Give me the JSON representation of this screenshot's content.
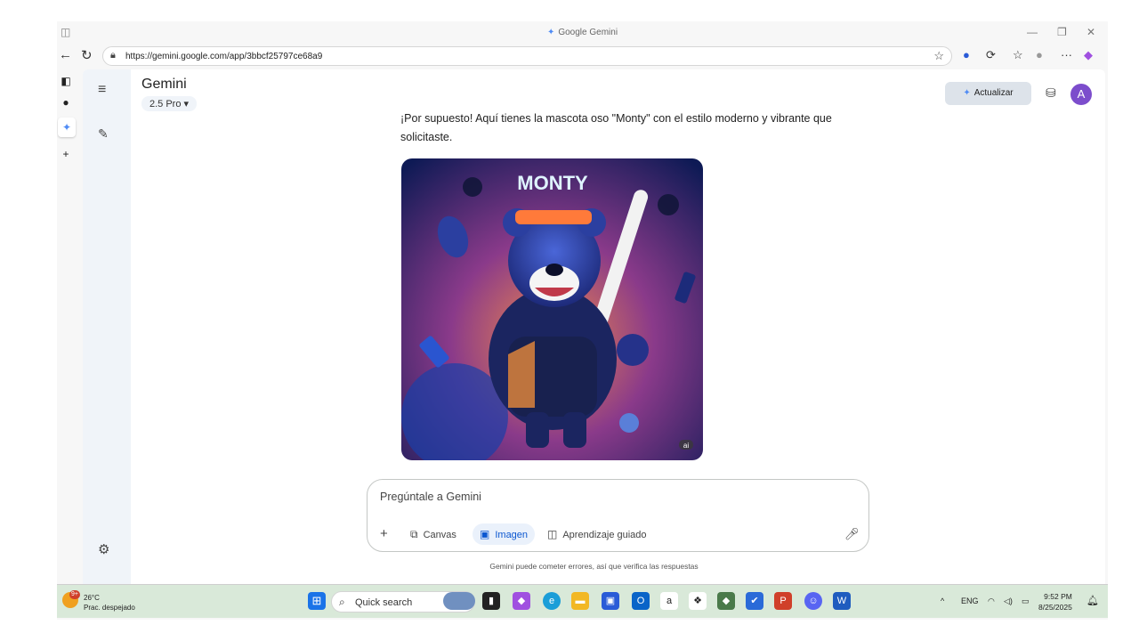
{
  "browser": {
    "window_title": "Google Gemini",
    "url": "https://gemini.google.com/app/3bbcf25797ce68a9"
  },
  "header": {
    "app_name": "Gemini",
    "model": "2.5 Pro",
    "upgrade_label": "Actualizar",
    "avatar_initial": "A"
  },
  "conversation": {
    "response_text": "¡Por supuesto! Aquí tienes la mascota oso \"Monty\" con el estilo moderno y vibrante que solicitaste.",
    "image_title": "MONTY",
    "image_badge": "ai"
  },
  "composer": {
    "placeholder": "Pregúntale a Gemini",
    "tools": [
      {
        "label": "Canvas",
        "icon": "canvas-icon"
      },
      {
        "label": "Imagen",
        "icon": "image-icon",
        "active": true
      },
      {
        "label": "Aprendizaje guiado",
        "icon": "book-icon"
      }
    ]
  },
  "disclaimer": "Gemini puede cometer errores, así que verifica las respuestas",
  "taskbar": {
    "weather_temp": "26°C",
    "weather_desc": "Prac. despejado",
    "weather_badge": "9+",
    "search_label": "Quick search",
    "language": "ENG",
    "time": "9:52 PM",
    "date": "8/25/2025"
  },
  "colors": {
    "accent": "#0b57d0",
    "avatar": "#7c4dcc",
    "rail_bg": "#f0f4f9"
  }
}
